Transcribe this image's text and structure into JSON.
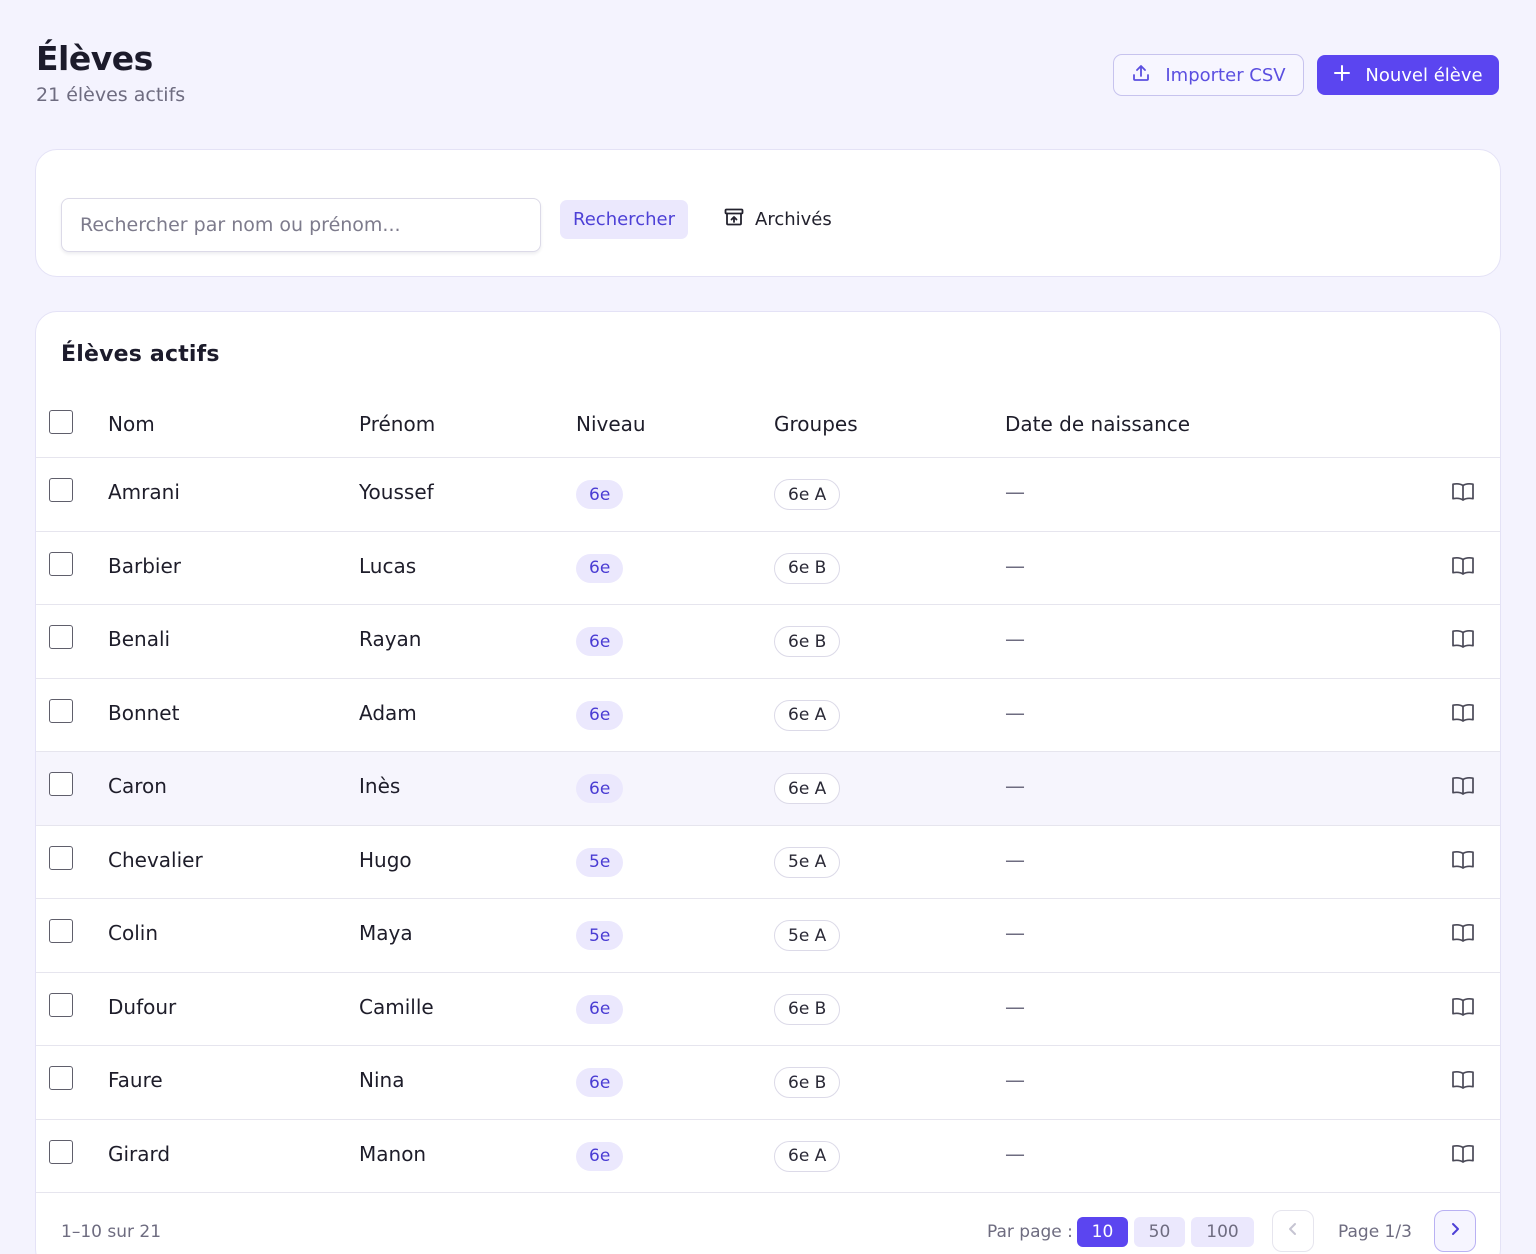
{
  "header": {
    "title": "Élèves",
    "subtitle": "21 élèves actifs",
    "import_label": "Importer CSV",
    "new_label": "Nouvel élève"
  },
  "search": {
    "placeholder": "Rechercher par nom ou prénom...",
    "value": "",
    "button_label": "Rechercher",
    "archived_label": "Archivés"
  },
  "table": {
    "title": "Élèves actifs",
    "columns": [
      "Nom",
      "Prénom",
      "Niveau",
      "Groupes",
      "Date de naissance"
    ],
    "rows": [
      {
        "nom": "Amrani",
        "prenom": "Youssef",
        "niveau": "6e",
        "groupe": "6e A",
        "naissance": "—"
      },
      {
        "nom": "Barbier",
        "prenom": "Lucas",
        "niveau": "6e",
        "groupe": "6e B",
        "naissance": "—"
      },
      {
        "nom": "Benali",
        "prenom": "Rayan",
        "niveau": "6e",
        "groupe": "6e B",
        "naissance": "—"
      },
      {
        "nom": "Bonnet",
        "prenom": "Adam",
        "niveau": "6e",
        "groupe": "6e A",
        "naissance": "—"
      },
      {
        "nom": "Caron",
        "prenom": "Inès",
        "niveau": "6e",
        "groupe": "6e A",
        "naissance": "—"
      },
      {
        "nom": "Chevalier",
        "prenom": "Hugo",
        "niveau": "5e",
        "groupe": "5e A",
        "naissance": "—"
      },
      {
        "nom": "Colin",
        "prenom": "Maya",
        "niveau": "5e",
        "groupe": "5e A",
        "naissance": "—"
      },
      {
        "nom": "Dufour",
        "prenom": "Camille",
        "niveau": "6e",
        "groupe": "6e B",
        "naissance": "—"
      },
      {
        "nom": "Faure",
        "prenom": "Nina",
        "niveau": "6e",
        "groupe": "6e B",
        "naissance": "—"
      },
      {
        "nom": "Girard",
        "prenom": "Manon",
        "niveau": "6e",
        "groupe": "6e A",
        "naissance": "—"
      }
    ]
  },
  "pagination": {
    "range_text": "1–10 sur 21",
    "per_page_label": "Par page :",
    "per_page_options": [
      "10",
      "50",
      "100"
    ],
    "per_page_selected": "10",
    "page_text": "Page 1/3"
  },
  "icons": {
    "import": "upload-icon",
    "new": "plus-icon",
    "archived": "archive-icon",
    "row_action": "book-open-icon",
    "prev": "chevron-left-icon",
    "next": "chevron-right-icon"
  },
  "colors": {
    "accent": "#5b45f0",
    "background": "#f4f3fe",
    "badge_bg": "#ebe8fd"
  }
}
